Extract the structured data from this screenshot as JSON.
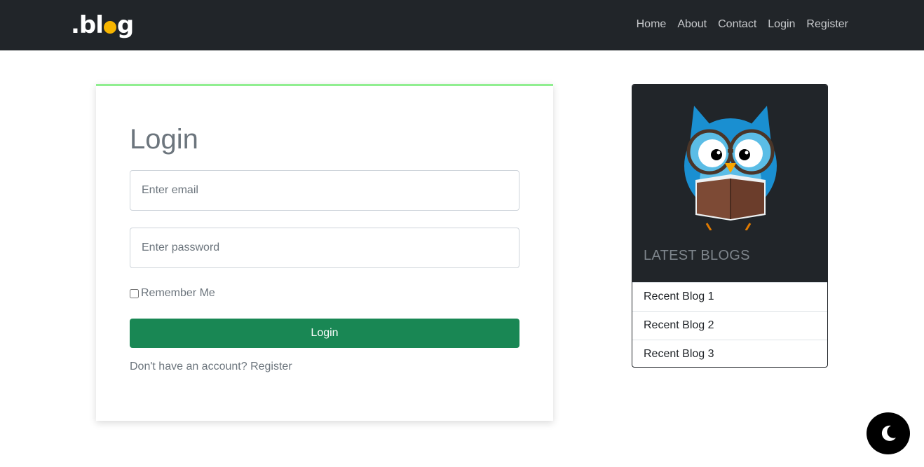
{
  "nav": {
    "logo": {
      "pre": ".bl",
      "post": "g"
    },
    "links": [
      "Home",
      "About",
      "Contact",
      "Login",
      "Register"
    ]
  },
  "login": {
    "title": "Login",
    "email_placeholder": "Enter email",
    "password_placeholder": "Enter password",
    "remember_label": "Remember Me",
    "button_label": "Login",
    "signup_text": "Don't have an account?",
    "signup_link": "Register"
  },
  "sidebar": {
    "title": "LATEST BLOGS",
    "image_icon": "owl-reading-icon",
    "items": [
      "Recent Blog 1",
      "Recent Blog 2",
      "Recent Blog 3"
    ]
  },
  "theme_toggle": {
    "icon": "moon-icon"
  },
  "colors": {
    "navbar": "#212529",
    "card_accent": "#90ee90",
    "button": "#198754",
    "logo_accent": "#f7b500"
  }
}
